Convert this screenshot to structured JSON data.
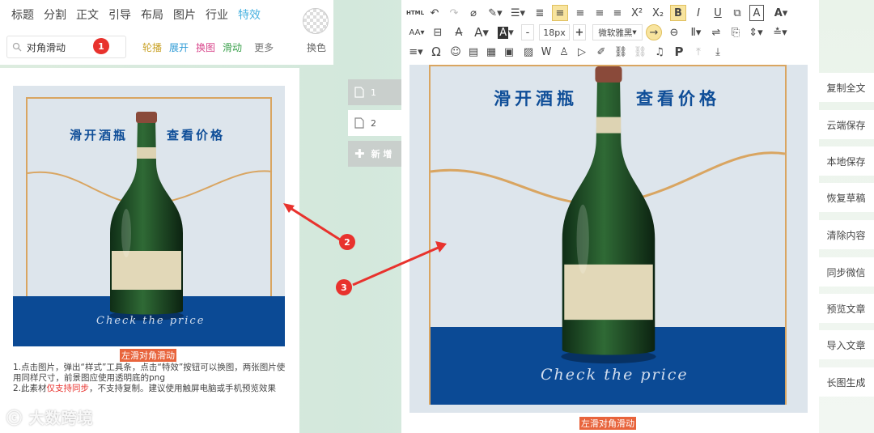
{
  "categories": [
    "标题",
    "分割",
    "正文",
    "引导",
    "布局",
    "图片",
    "行业",
    "特效"
  ],
  "active_category": "特效",
  "search": {
    "value": "对角滑动"
  },
  "subtabs": [
    {
      "label": "轮播",
      "color": "#c9a227"
    },
    {
      "label": "展开",
      "color": "#2e9bd6"
    },
    {
      "label": "换图",
      "color": "#d8458b"
    },
    {
      "label": "滑动",
      "color": "#38a04a"
    },
    {
      "label": "更多",
      "color": "#777777"
    }
  ],
  "swap_bg_label": "换色",
  "badges": [
    "1",
    "2",
    "3"
  ],
  "template": {
    "poster_title_left": "滑开酒瓶",
    "poster_title_right": "查看价格",
    "poster_cta": "Check the price",
    "caption": "左滑对角滑动",
    "instructions_1": "1.点击图片，弹出“样式”工具条，点击“特效”按钮可以换图，两张图片使用同样尺寸，前景图应使用透明底的png",
    "instructions_2_a": "2.此素材",
    "instructions_2_red": "仅支持同步",
    "instructions_2_b": "，不支持复制。建议使用触屏电脑或手机预览效果"
  },
  "pages": [
    {
      "label": "1",
      "state": "inactive"
    },
    {
      "label": "2",
      "state": "active"
    }
  ],
  "add_page_label": "新 增",
  "toolbar": {
    "html_label": "HTML",
    "superscript": "X²",
    "subscript": "X₂",
    "font_size": "18px",
    "font_family": "微软雅黑",
    "font_size_decrease": "-",
    "font_size_increase": "+"
  },
  "editor_caption": "左滑对角滑动",
  "right_actions": [
    "复制全文",
    "云端保存",
    "本地保存",
    "恢复草稿",
    "清除内容",
    "同步微信",
    "预览文章",
    "导入文章",
    "长图生成"
  ],
  "watermark": "大数跨境",
  "colors": {
    "accent": "#4bb3e0",
    "badge": "#e8322d",
    "poster_blue": "#0b4a95",
    "frame_gold": "#d9a561",
    "bottle": "#1f4a26"
  }
}
